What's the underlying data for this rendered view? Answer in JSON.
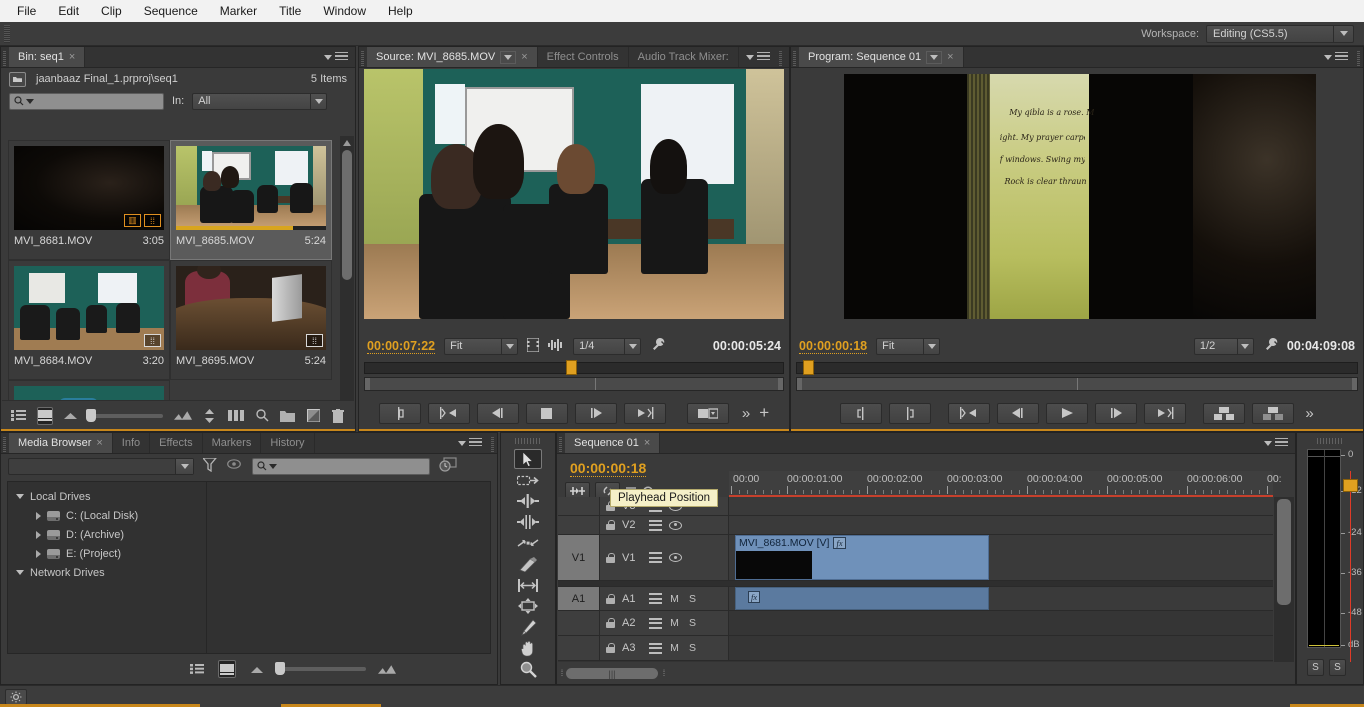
{
  "menubar": {
    "items": [
      "File",
      "Edit",
      "Clip",
      "Sequence",
      "Marker",
      "Title",
      "Window",
      "Help"
    ]
  },
  "workspace": {
    "label": "Workspace:",
    "value": "Editing (CS5.5)"
  },
  "bin": {
    "tab_label": "Bin: seq1",
    "close_glyph": "×",
    "path": "jaanbaaz Final_1.prproj\\seq1",
    "item_count": "5 Items",
    "search_placeholder": "",
    "in_label": "In:",
    "in_value": "All",
    "clips": [
      {
        "name": "MVI_8681.MOV",
        "duration": "3:05",
        "scene": "dark",
        "selected": false,
        "badges": [
          "film",
          "audio"
        ],
        "badge_color": "orange",
        "progress": 0
      },
      {
        "name": "MVI_8685.MOV",
        "duration": "5:24",
        "scene": "office",
        "selected": true,
        "badges": [],
        "badge_color": "white",
        "progress": 78
      },
      {
        "name": "MVI_8684.MOV",
        "duration": "3:20",
        "scene": "room",
        "selected": false,
        "badges": [
          "audio"
        ],
        "badge_color": "white",
        "progress": 0
      },
      {
        "name": "MVI_8695.MOV",
        "duration": "5:24",
        "scene": "table",
        "selected": false,
        "badges": [
          "audio"
        ],
        "badge_color": "white",
        "progress": 0
      }
    ],
    "bottom_tools": [
      "list-view-icon",
      "icon-view-icon",
      "zoom-out-icon",
      "zoom-slider",
      "zoom-in-icon",
      "sort-icon",
      "automate-to-sequence-icon",
      "find-icon",
      "new-bin-icon",
      "new-item-icon",
      "clear-icon"
    ]
  },
  "source_monitor": {
    "tabs": [
      {
        "label": "Source: MVI_8685.MOV",
        "active": true,
        "has_dropdown": true,
        "has_close": true
      },
      {
        "label": "Effect Controls",
        "active": false
      },
      {
        "label": "Audio Track Mixer:",
        "active": false,
        "has_menu": true
      }
    ],
    "playhead_timecode": "00:00:07:22",
    "fit_value": "Fit",
    "quality_value": "1/4",
    "duration_timecode": "00:00:05:24",
    "transport": [
      "mark-in-icon",
      "go-to-in-icon",
      "step-back-icon",
      "stop-icon",
      "play-icon",
      "step-forward-icon",
      "go-to-out-icon",
      "insert-icon",
      "more-icon",
      "add-marker-icon"
    ]
  },
  "program_monitor": {
    "tab_label": "Program: Sequence 01",
    "playhead_timecode": "00:00:00:18",
    "fit_value": "Fit",
    "quality_value": "1/2",
    "duration_timecode": "00:04:09:08",
    "transport": [
      "mark-in-icon",
      "mark-out-icon",
      "go-to-in-icon",
      "step-back-icon",
      "play-icon",
      "step-forward-icon",
      "go-to-out-icon",
      "lift-icon",
      "extract-icon",
      "more-icon"
    ]
  },
  "media_browser": {
    "tabs": [
      {
        "label": "Media Browser",
        "active": true,
        "has_close": true
      },
      {
        "label": "Info",
        "active": false
      },
      {
        "label": "Effects",
        "active": false
      },
      {
        "label": "Markers",
        "active": false
      },
      {
        "label": "History",
        "active": false
      }
    ],
    "dir_select_value": "",
    "search_placeholder": "",
    "toolbar_icons": [
      "filter-icon",
      "visibility-icon",
      "search-icon",
      "recent-icon"
    ],
    "tree": [
      {
        "label": "Local Drives",
        "level": 0,
        "expanded": true,
        "icon": "none"
      },
      {
        "label": "C: (Local Disk)",
        "level": 1,
        "expanded": false,
        "icon": "drive"
      },
      {
        "label": "D: (Archive)",
        "level": 1,
        "expanded": false,
        "icon": "drive"
      },
      {
        "label": "E: (Project)",
        "level": 1,
        "expanded": false,
        "icon": "drive"
      },
      {
        "label": "Network Drives",
        "level": 0,
        "expanded": true,
        "icon": "none"
      }
    ],
    "bottom_icons": [
      "list-view-icon",
      "icon-view-icon",
      "zoom-out-icon",
      "zoom-slider",
      "zoom-in-icon"
    ]
  },
  "tools": {
    "items": [
      {
        "name": "selection-tool",
        "glyph": "arrow",
        "active": true
      },
      {
        "name": "track-select-tool",
        "glyph": "track",
        "active": false
      },
      {
        "name": "ripple-edit-tool",
        "glyph": "ripple",
        "active": false
      },
      {
        "name": "rolling-edit-tool",
        "glyph": "rolling",
        "active": false
      },
      {
        "name": "rate-stretch-tool",
        "glyph": "rate",
        "active": false
      },
      {
        "name": "razor-tool",
        "glyph": "razor",
        "active": false
      },
      {
        "name": "slip-tool",
        "glyph": "slip",
        "active": false
      },
      {
        "name": "slide-tool",
        "glyph": "slide",
        "active": false
      },
      {
        "name": "pen-tool",
        "glyph": "pen",
        "active": false
      },
      {
        "name": "hand-tool",
        "glyph": "hand",
        "active": false
      },
      {
        "name": "zoom-tool",
        "glyph": "zoom",
        "active": false
      }
    ]
  },
  "timeline": {
    "tab_label": "Sequence 01",
    "playhead_timecode": "00:00:00:18",
    "tooltip": "Playhead Position",
    "ruler_labels": [
      "00:00",
      "00:00:01:00",
      "00:00:02:00",
      "00:00:03:00",
      "00:00:04:00",
      "00:00:05:00",
      "00:00:06:00",
      "00:"
    ],
    "video_tracks": [
      {
        "name": "V3",
        "source_indicator": "",
        "locked": false
      },
      {
        "name": "V2",
        "source_indicator": "",
        "locked": false
      },
      {
        "name": "V1",
        "source_indicator": "V1",
        "locked": false
      }
    ],
    "audio_tracks": [
      {
        "name": "A1",
        "source_indicator": "A1",
        "mute": "M",
        "solo": "S"
      },
      {
        "name": "A2",
        "source_indicator": "",
        "mute": "M",
        "solo": "S"
      },
      {
        "name": "A3",
        "source_indicator": "",
        "mute": "M",
        "solo": "S"
      }
    ],
    "clips": [
      {
        "track": "V1",
        "label": "MVI_8681.MOV [V]",
        "has_fx": true
      },
      {
        "track": "A1",
        "label": "",
        "has_fx": true
      }
    ]
  },
  "audio_meters": {
    "scale_labels": [
      "0",
      "-12",
      "-24",
      "-36",
      "-48",
      "dB"
    ],
    "solo_buttons": [
      "S",
      "S"
    ]
  },
  "statusbar": {
    "icon": "settings-icon"
  },
  "colors": {
    "accent_orange": "#c8871b",
    "timecode_orange": "#e0a020",
    "clip_blue": "#6f91ba",
    "playhead_red": "#e03b28",
    "panel_bg": "#3a3a3a"
  }
}
